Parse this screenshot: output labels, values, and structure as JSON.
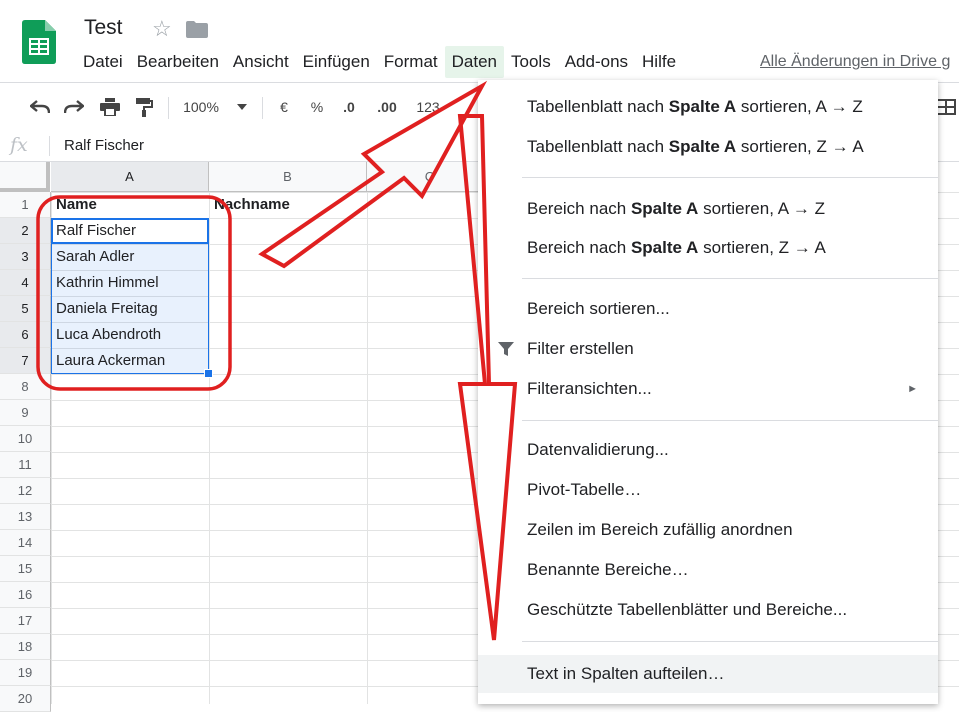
{
  "app": {
    "doc_title": "Test",
    "menu": [
      "Datei",
      "Bearbeiten",
      "Ansicht",
      "Einfügen",
      "Format",
      "Daten",
      "Tools",
      "Add-ons",
      "Hilfe"
    ],
    "saved_status": "Alle Änderungen in Drive g"
  },
  "toolbar": {
    "zoom": "100%",
    "currency": "€",
    "percent": "%",
    "dec_less": ".0",
    "dec_more": ".00",
    "number_format": "123"
  },
  "formula_bar": {
    "fx": "fx",
    "value": "Ralf Fischer"
  },
  "grid": {
    "columns": [
      "A",
      "B",
      "C"
    ],
    "rows": [
      "1",
      "2",
      "3",
      "4",
      "5",
      "6",
      "7",
      "8",
      "9",
      "10",
      "11",
      "12",
      "13",
      "14",
      "15",
      "16",
      "17",
      "18",
      "19",
      "20"
    ],
    "cells": {
      "A1": "Name",
      "B1": "Nachname",
      "A2": "Ralf Fischer",
      "A3": "Sarah Adler",
      "A4": "Kathrin Himmel",
      "A5": "Daniela Freitag",
      "A6": "Luca Abendroth",
      "A7": "Laura Ackerman"
    }
  },
  "daten_menu": {
    "sort_sheet_az": {
      "pre": "Tabellenblatt nach ",
      "bold": "Spalte A",
      "post": " sortieren, A → Z"
    },
    "sort_sheet_za": {
      "pre": "Tabellenblatt nach ",
      "bold": "Spalte A",
      "post": " sortieren, Z → A"
    },
    "sort_range_az": {
      "pre": "Bereich nach ",
      "bold": "Spalte A",
      "post": " sortieren, A → Z"
    },
    "sort_range_za": {
      "pre": "Bereich nach ",
      "bold": "Spalte A",
      "post": " sortieren, Z → A"
    },
    "sort_range": "Bereich sortieren...",
    "create_filter": "Filter erstellen",
    "filter_views": "Filteransichten...",
    "data_validation": "Datenvalidierung...",
    "pivot_table": "Pivot-Tabelle…",
    "randomize_range": "Zeilen im Bereich zufällig anordnen",
    "named_ranges": "Benannte Bereiche…",
    "protected_sheets": "Geschützte Tabellenblätter und Bereiche...",
    "split_text": "Text in Spalten aufteilen…"
  },
  "colors": {
    "sheets_green": "#0f9d58",
    "selection_blue": "#1a73e8",
    "annotation_red": "#e02020"
  }
}
